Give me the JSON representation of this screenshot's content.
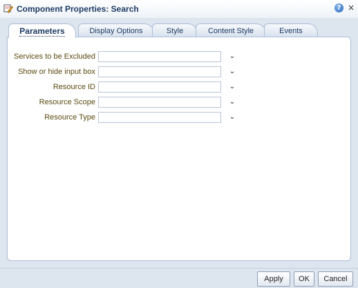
{
  "window": {
    "title": "Component Properties: Search",
    "app_icon": "pencil-edit-icon",
    "help_icon": "?",
    "close_icon": "×"
  },
  "tabs": [
    {
      "label": "Parameters",
      "active": true
    },
    {
      "label": "Display Options",
      "active": false
    },
    {
      "label": "Style",
      "active": false
    },
    {
      "label": "Content Style",
      "active": false
    },
    {
      "label": "Events",
      "active": false
    }
  ],
  "fields": [
    {
      "label": "Services to be Excluded",
      "value": ""
    },
    {
      "label": "Show or hide input box",
      "value": ""
    },
    {
      "label": "Resource ID",
      "value": ""
    },
    {
      "label": "Resource Scope",
      "value": ""
    },
    {
      "label": "Resource Type",
      "value": ""
    }
  ],
  "dropdown_icon": "⌄",
  "buttons": {
    "apply": "Apply",
    "ok": "OK",
    "cancel": "Cancel"
  },
  "colors": {
    "title": "#1d3a63",
    "label": "#5a4a10",
    "background": "#dde5ef"
  }
}
